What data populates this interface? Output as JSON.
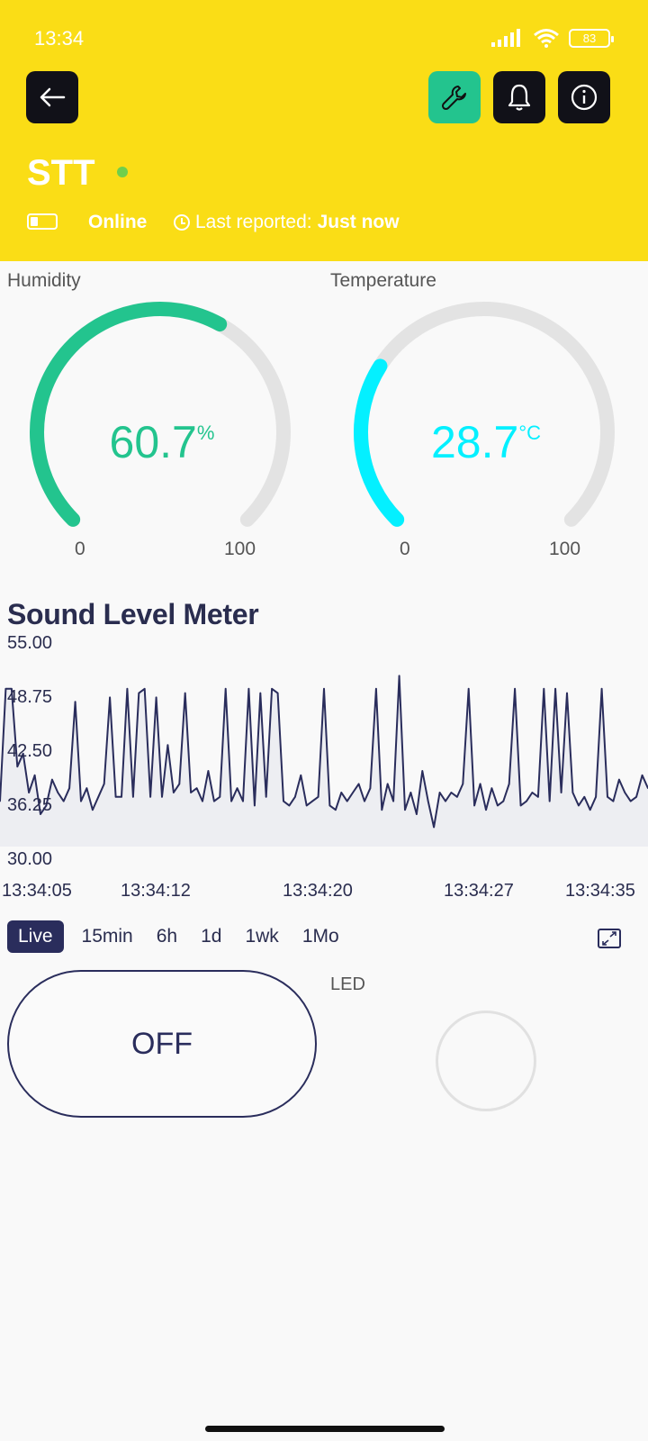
{
  "status_bar": {
    "time": "13:34",
    "battery": "83"
  },
  "header": {
    "device_name": "STT",
    "status": "Online",
    "last_reported_label": "Last reported:",
    "last_reported_value": "Just now"
  },
  "humidity": {
    "label": "Humidity",
    "value": "60.7",
    "unit": "%",
    "min": "0",
    "max": "100",
    "level": 60.7,
    "color": "#23c48e"
  },
  "temperature": {
    "label": "Temperature",
    "value": "28.7",
    "unit": "°C",
    "min": "0",
    "max": "100",
    "level": 28.7,
    "color": "#04f0ff"
  },
  "sound_meter": {
    "title": "Sound Level Meter",
    "y_ticks": [
      "55.00",
      "48.75",
      "42.50",
      "36.25",
      "30.00"
    ],
    "x_ticks": [
      "13:34:05",
      "13:34:12",
      "13:34:20",
      "13:34:27",
      "13:34:35"
    ],
    "ranges": [
      "Live",
      "15min",
      "6h",
      "1d",
      "1wk",
      "1Mo"
    ],
    "active_range": "Live"
  },
  "chart_data": {
    "type": "line",
    "title": "Sound Level Meter",
    "ylim": [
      30,
      55
    ],
    "series": [
      {
        "values": [
          36.5,
          49.5,
          49.5,
          40.5,
          42,
          37.5,
          39.5,
          35,
          36,
          39,
          37.5,
          36.5,
          38,
          48,
          36.5,
          38,
          35.5,
          37,
          38.5,
          48.5,
          37,
          37,
          49.5,
          37,
          49,
          49.5,
          37,
          48.5,
          37,
          43,
          37.5,
          38.5,
          49,
          37.5,
          38,
          36.5,
          40,
          36.5,
          37,
          49.5,
          36.5,
          38,
          36.5,
          49.5,
          36,
          49,
          37,
          49.5,
          49,
          36.5,
          36,
          37,
          39.5,
          36,
          36.5,
          37,
          49.5,
          36,
          35.5,
          37.5,
          36.5,
          37.5,
          38.5,
          36.5,
          38,
          49.5,
          35.5,
          38.5,
          36.5,
          51,
          35.5,
          37.5,
          35,
          40,
          36.5,
          33.5,
          37.5,
          36.5,
          37.5,
          37,
          38.5,
          49.5,
          36,
          38.5,
          35.5,
          38,
          36,
          36.5,
          38.5,
          49.5,
          36,
          36.5,
          37.5,
          37,
          49.5,
          36.5,
          49.5,
          37.5,
          49,
          37.5,
          36,
          37,
          35.5,
          37,
          49.5,
          37,
          36.5,
          39,
          37.5,
          36.5,
          37,
          39.5,
          38
        ]
      }
    ]
  },
  "led": {
    "button_label": "OFF",
    "label": "LED"
  },
  "icons": [
    "back-arrow-icon",
    "wrench-icon",
    "bell-icon",
    "info-icon",
    "clock-icon",
    "battery-icon",
    "wifi-icon",
    "signal-icon",
    "expand-icon"
  ]
}
